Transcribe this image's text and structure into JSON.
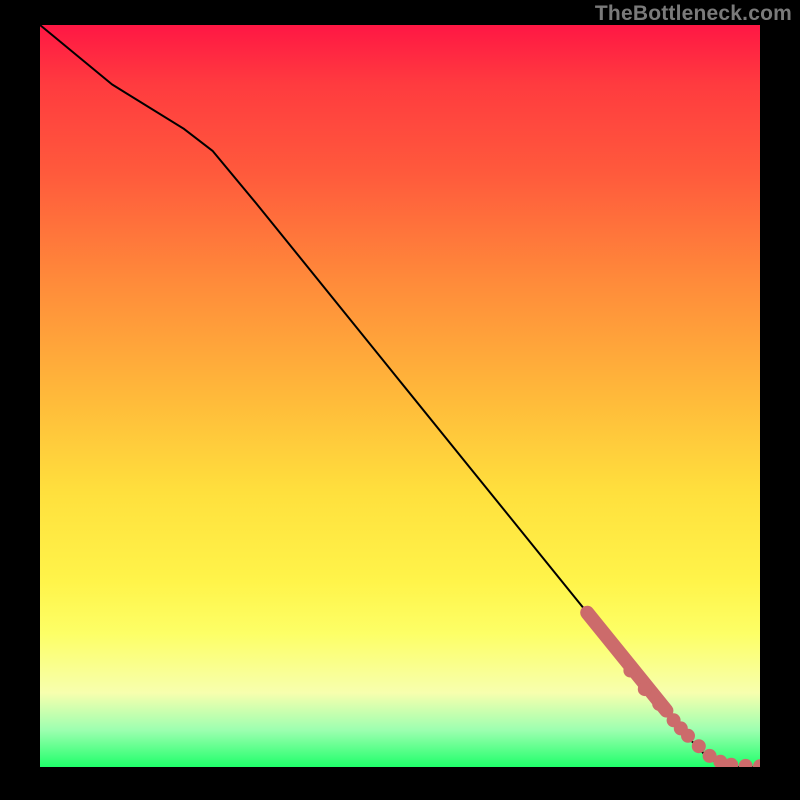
{
  "watermark": "TheBottleneck.com",
  "chart_data": {
    "type": "line",
    "title": "",
    "xlabel": "",
    "ylabel": "",
    "xlim": [
      0,
      100
    ],
    "ylim": [
      0,
      100
    ],
    "grid": false,
    "legend": false,
    "curve": {
      "x": [
        0,
        10,
        20,
        24,
        30,
        40,
        50,
        60,
        70,
        80,
        85,
        90,
        93,
        96,
        100
      ],
      "y": [
        100,
        92,
        86,
        83,
        76,
        64,
        52,
        40,
        28,
        16,
        10,
        4,
        1,
        0,
        0
      ]
    },
    "highlight_segment": {
      "x_start": 76,
      "x_end": 87
    },
    "points": {
      "x": [
        82,
        84,
        86,
        88,
        89,
        90,
        91.5,
        93,
        94.5,
        96,
        98,
        100
      ],
      "y": [
        13,
        10.5,
        8.5,
        6.3,
        5.2,
        4.2,
        2.8,
        1.5,
        0.7,
        0.3,
        0.15,
        0.1
      ]
    }
  }
}
